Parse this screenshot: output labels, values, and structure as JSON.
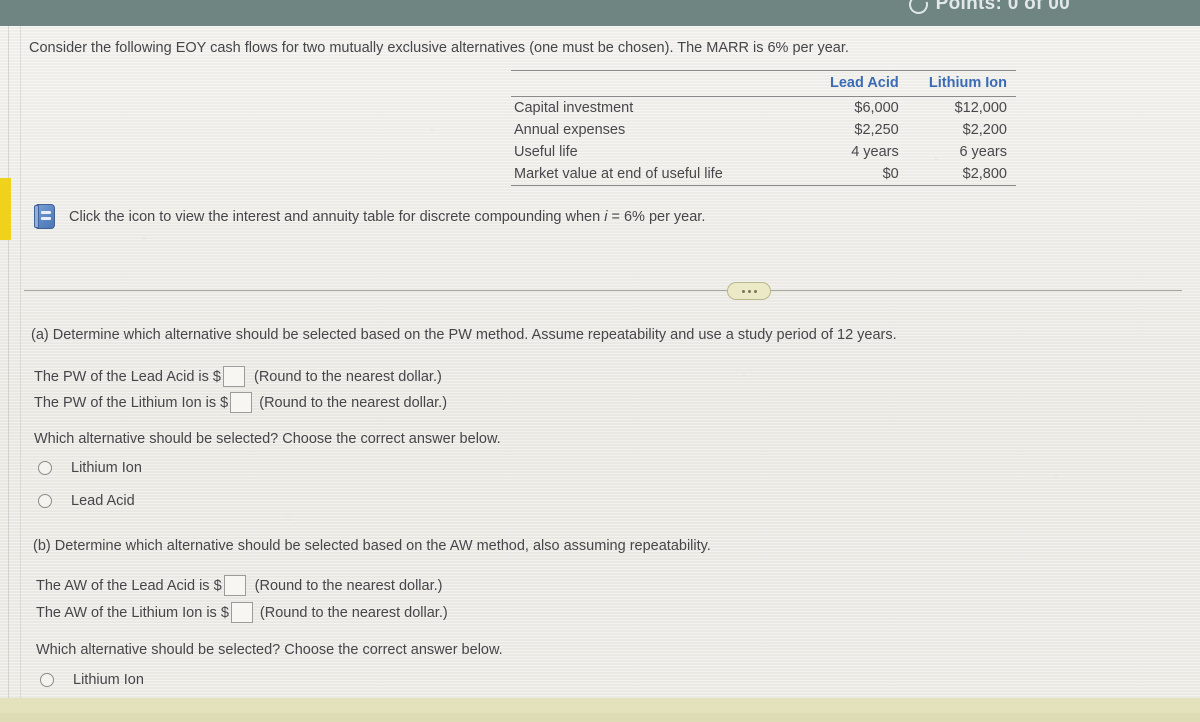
{
  "topbar": {
    "refresh_icon": "refresh-icon",
    "label": "Points: 0 of 00",
    "background_color": "#6e8581"
  },
  "prompt": "Consider the following EOY cash flows for two mutually exclusive alternatives (one must be chosen). The MARR is 6% per year.",
  "table": {
    "headers": [
      "",
      "Lead Acid",
      "Lithium Ion"
    ],
    "header_color": "#3a6cb4",
    "rows": [
      {
        "label": "Capital investment",
        "lead_acid": "$6,000",
        "lithium_ion": "$12,000"
      },
      {
        "label": "Annual expenses",
        "lead_acid": "$2,250",
        "lithium_ion": "$2,200"
      },
      {
        "label": "Useful life",
        "lead_acid": "4 years",
        "lithium_ion": "6 years"
      },
      {
        "label": "Market value at end of useful life",
        "lead_acid": "$0",
        "lithium_ion": "$2,800"
      }
    ]
  },
  "icon_link": {
    "icon": "book-icon",
    "text_before": "Click the icon to view the interest and annuity table for discrete compounding when ",
    "italic_var": "i",
    "text_after": " = 6% per year."
  },
  "divider": {
    "expand_button": "ellipsis-button"
  },
  "part_a": {
    "question": "(a) Determine which alternative should be selected based on the PW method. Assume repeatability and use a study period of 12 years.",
    "line1_prefix": "The PW of the Lead Acid is $",
    "line1_value": "",
    "line1_hint": "(Round to the nearest dollar.)",
    "line2_prefix": "The PW of the Lithium Ion is $",
    "line2_value": "",
    "line2_hint": "(Round to the nearest dollar.)",
    "choose_prompt": "Which alternative should be selected? Choose the correct answer below.",
    "options": [
      "Lithium Ion",
      "Lead Acid"
    ]
  },
  "part_b": {
    "question": "(b) Determine which alternative should be selected based on the AW method, also assuming repeatability.",
    "line1_prefix": "The AW of the Lead Acid is $",
    "line1_value": "",
    "line1_hint": "(Round to the nearest dollar.)",
    "line2_prefix": "The AW of the Lithium Ion is $",
    "line2_value": "",
    "line2_hint": "(Round to the nearest dollar.)",
    "choose_prompt": "Which alternative should be selected? Choose the correct answer below.",
    "options": [
      "Lithium Ion"
    ]
  }
}
